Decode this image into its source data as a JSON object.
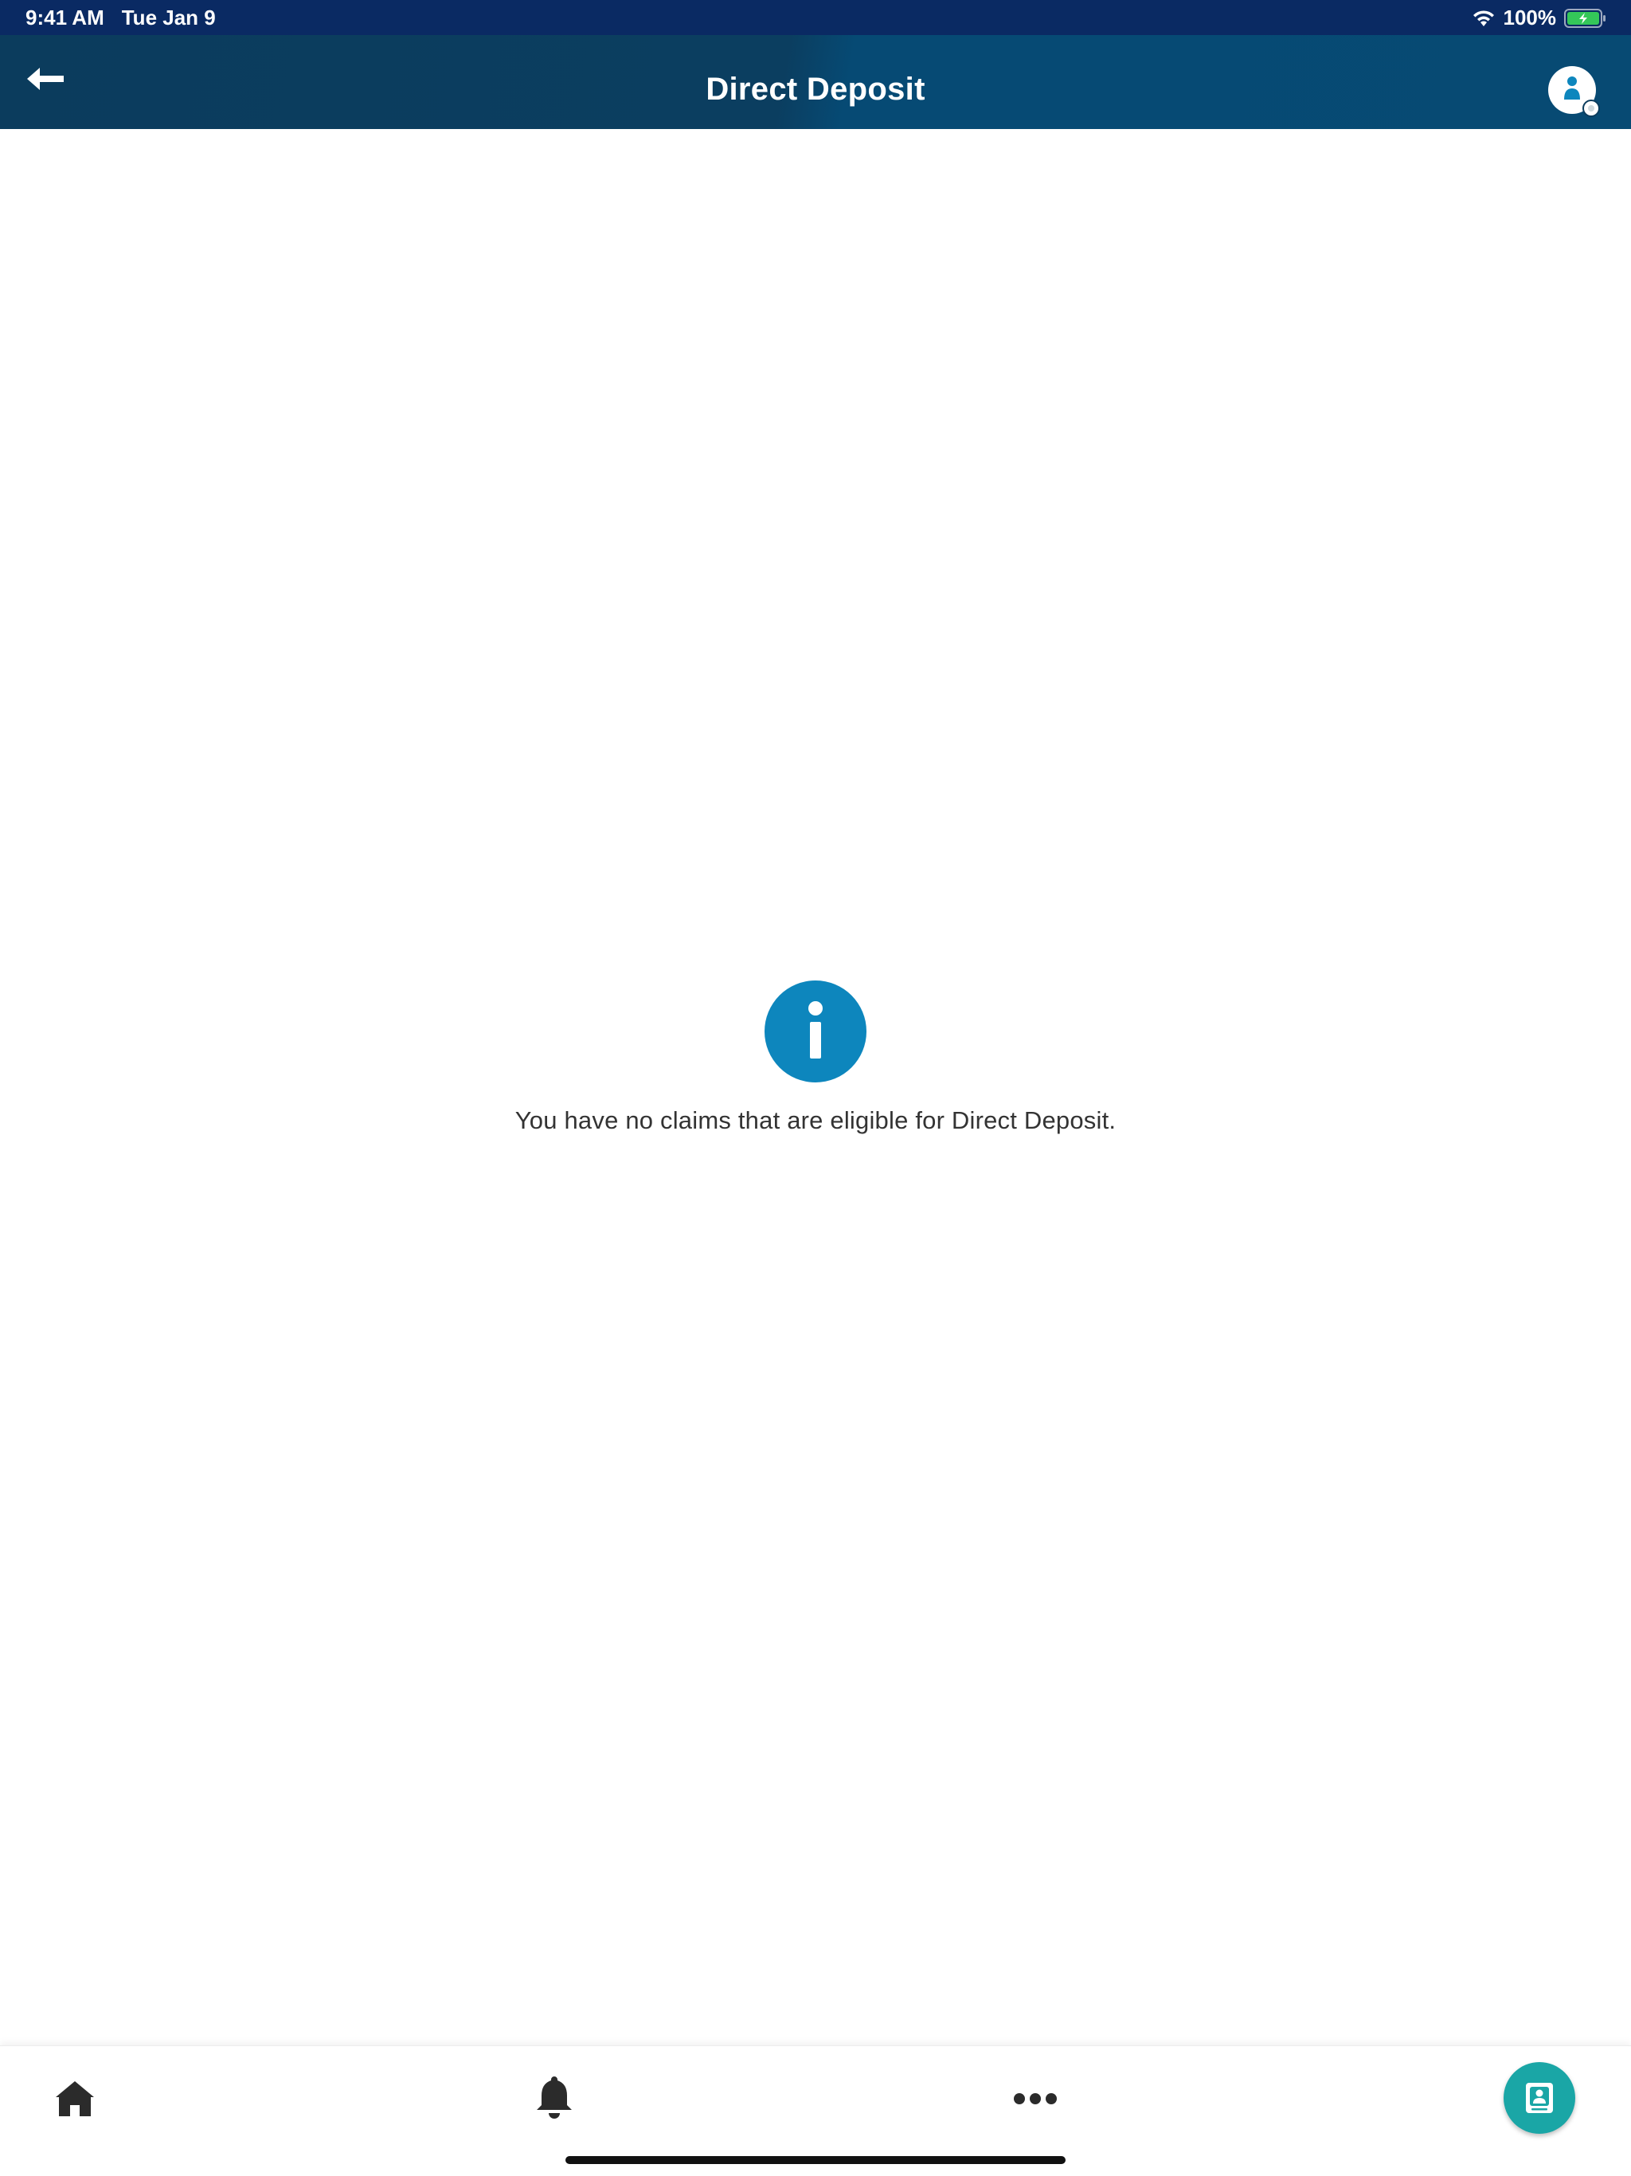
{
  "status_bar": {
    "time": "9:41 AM",
    "date": "Tue Jan 9",
    "battery_percent": "100%",
    "wifi_icon": "wifi-icon",
    "battery_icon": "battery-charging-icon"
  },
  "header": {
    "title": "Direct Deposit",
    "back_icon": "arrow-left-icon",
    "profile_icon": "user-profile-icon"
  },
  "main": {
    "info_icon": "info-icon",
    "message": "You have no claims that are eligible for Direct Deposit."
  },
  "bottom_nav": {
    "items": [
      {
        "icon": "home-icon"
      },
      {
        "icon": "bell-icon"
      },
      {
        "icon": "more-icon"
      },
      {
        "icon": "claim-card-icon"
      }
    ]
  },
  "colors": {
    "status_bar": "#0a2a63",
    "header": "#0b3c5d",
    "info_blue": "#0d86bd",
    "claim_teal": "#1aa6a6"
  }
}
